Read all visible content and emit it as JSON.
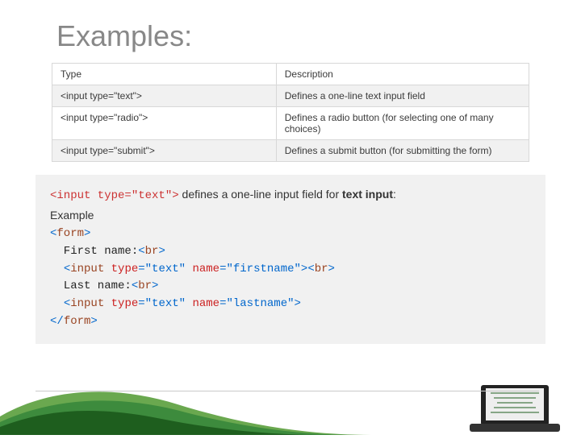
{
  "title": "Examples:",
  "table": {
    "headers": {
      "type": "Type",
      "description": "Description"
    },
    "rows": [
      {
        "type": "<input type=\"text\">",
        "desc": "Defines a one-line text input field"
      },
      {
        "type": "<input type=\"radio\">",
        "desc": "Defines a radio button (for selecting one of many choices)"
      },
      {
        "type": "<input type=\"submit\">",
        "desc": "Defines a submit button (for submitting the form)"
      }
    ]
  },
  "example": {
    "intro_code": "<input type=\"text\">",
    "intro_mid": " defines a one-line input field for ",
    "intro_bold": "text input",
    "intro_tail": ":",
    "label": "Example",
    "code": {
      "l1_open": "<",
      "l1_tag": "form",
      "l1_close": ">",
      "l2_text": "  First name:",
      "l2_br_o": "<",
      "l2_br_t": "br",
      "l2_br_c": ">",
      "l3_o": "<",
      "l3_tag": "input",
      "l3_sp": " ",
      "l3_a1n": "type",
      "l3_a1e": "=\"text\"",
      "l3_sp2": " ",
      "l3_a2n": "name",
      "l3_a2e": "=\"firstname\"",
      "l3_c": ">",
      "l3_br_o": "<",
      "l3_br_t": "br",
      "l3_br_c": ">",
      "l4_text": "  Last name:",
      "l4_br_o": "<",
      "l4_br_t": "br",
      "l4_br_c": ">",
      "l5_o": "<",
      "l5_tag": "input",
      "l5_sp": " ",
      "l5_a1n": "type",
      "l5_a1e": "=\"text\"",
      "l5_sp2": " ",
      "l5_a2n": "name",
      "l5_a2e": "=\"lastname\"",
      "l5_c": ">",
      "l6_o": "</",
      "l6_tag": "form",
      "l6_c": ">"
    }
  }
}
